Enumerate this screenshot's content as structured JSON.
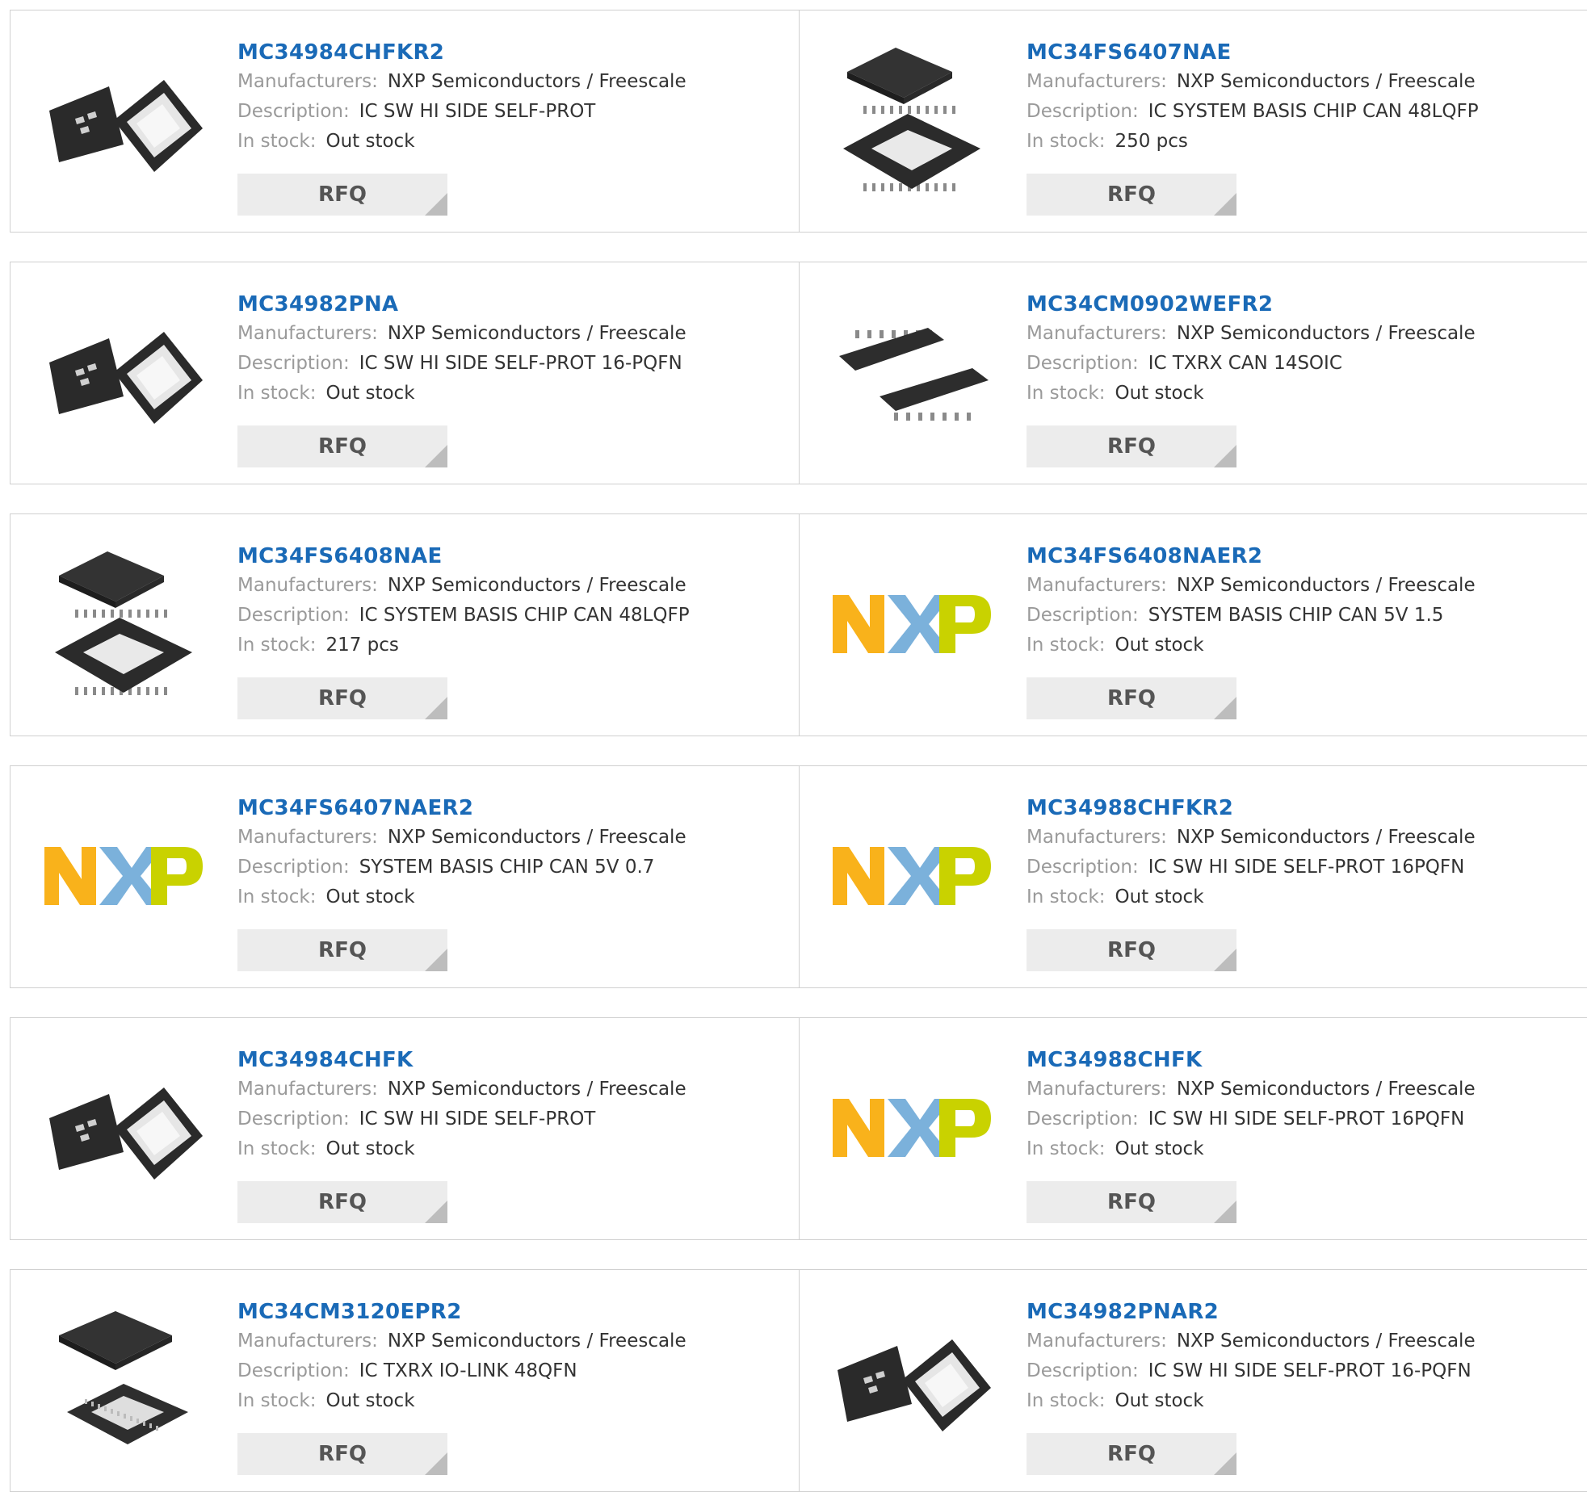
{
  "labels": {
    "manufacturers": "Manufacturers:",
    "description": "Description:",
    "in_stock": "In stock:",
    "rfq": "RFQ"
  },
  "products": [
    {
      "part": "MC34984CHFKR2",
      "manufacturer": "NXP Semiconductors / Freescale",
      "description": "IC SW HI SIDE SELF-PROT",
      "stock": "Out stock",
      "image": "qfn-chip-icon"
    },
    {
      "part": "MC34FS6407NAE",
      "manufacturer": "NXP Semiconductors / Freescale",
      "description": "IC SYSTEM BASIS CHIP CAN 48LQFP",
      "stock": "250 pcs",
      "image": "lqfp-chip-icon"
    },
    {
      "part": "MC34982PNA",
      "manufacturer": "NXP Semiconductors / Freescale",
      "description": "IC SW HI SIDE SELF-PROT 16-PQFN",
      "stock": "Out stock",
      "image": "qfn-chip-icon"
    },
    {
      "part": "MC34CM0902WEFR2",
      "manufacturer": "NXP Semiconductors / Freescale",
      "description": "IC TXRX CAN 14SOIC",
      "stock": "Out stock",
      "image": "soic-chip-icon"
    },
    {
      "part": "MC34FS6408NAE",
      "manufacturer": "NXP Semiconductors / Freescale",
      "description": "IC SYSTEM BASIS CHIP CAN 48LQFP",
      "stock": "217 pcs",
      "image": "lqfp-chip-icon"
    },
    {
      "part": "MC34FS6408NAER2",
      "manufacturer": "NXP Semiconductors / Freescale",
      "description": "SYSTEM BASIS CHIP CAN 5V 1.5",
      "stock": "Out stock",
      "image": "nxp-logo"
    },
    {
      "part": "MC34FS6407NAER2",
      "manufacturer": "NXP Semiconductors / Freescale",
      "description": "SYSTEM BASIS CHIP CAN 5V 0.7",
      "stock": "Out stock",
      "image": "nxp-logo"
    },
    {
      "part": "MC34988CHFKR2",
      "manufacturer": "NXP Semiconductors / Freescale",
      "description": "IC SW HI SIDE SELF-PROT 16PQFN",
      "stock": "Out stock",
      "image": "nxp-logo"
    },
    {
      "part": "MC34984CHFK",
      "manufacturer": "NXP Semiconductors / Freescale",
      "description": "IC SW HI SIDE SELF-PROT",
      "stock": "Out stock",
      "image": "qfn-chip-icon"
    },
    {
      "part": "MC34988CHFK",
      "manufacturer": "NXP Semiconductors / Freescale",
      "description": "IC SW HI SIDE SELF-PROT 16PQFN",
      "stock": "Out stock",
      "image": "nxp-logo"
    },
    {
      "part": "MC34CM3120EPR2",
      "manufacturer": "NXP Semiconductors / Freescale",
      "description": "IC TXRX IO-LINK 48QFN",
      "stock": "Out stock",
      "image": "qfn48-chip-icon"
    },
    {
      "part": "MC34982PNAR2",
      "manufacturer": "NXP Semiconductors / Freescale",
      "description": "IC SW HI SIDE SELF-PROT 16-PQFN",
      "stock": "Out stock",
      "image": "qfn-chip-icon"
    }
  ],
  "colors": {
    "title": "#1a6ab7",
    "label": "#9a9a9a",
    "value": "#333333",
    "rfq_bg": "#ececec",
    "nxp_orange": "#f9b21b",
    "nxp_blue": "#7bb1db",
    "nxp_green": "#c9d200"
  }
}
